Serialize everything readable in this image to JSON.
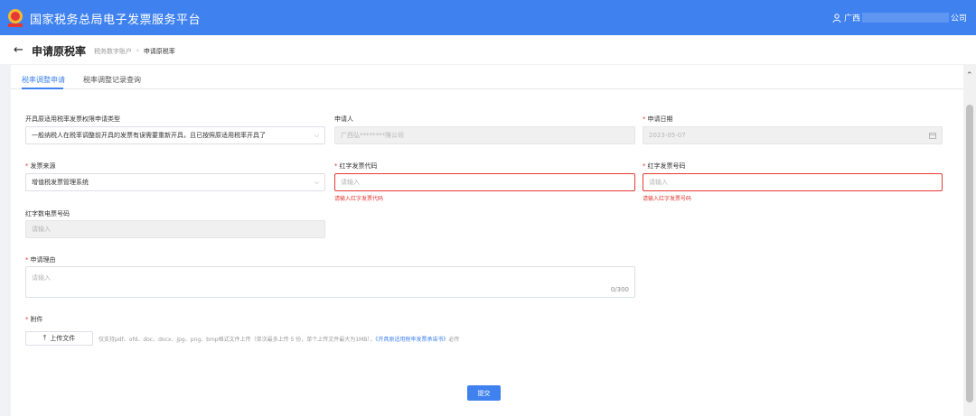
{
  "topbar": {
    "app_title": "国家税务总局电子发票服务平台",
    "user_prefix": "广西",
    "user_suffix": "公司"
  },
  "header": {
    "back_icon": "←",
    "page_title": "申请原税率",
    "breadcrumb": [
      "税务数字账户",
      "申请原税率"
    ]
  },
  "tabs": [
    {
      "label": "税率调整申请",
      "active": true
    },
    {
      "label": "税率调整记录查询",
      "active": false
    }
  ],
  "form": {
    "invoice_type": {
      "label": "开具原适用税率发票权限申请类型",
      "value": "一般纳税人在税率调整前开具的发票有误需要重新开具，且已按照原适用税率开具了"
    },
    "applicant": {
      "label": "申请人",
      "value": "广西弘********限公司"
    },
    "apply_date": {
      "label": "申请日期",
      "value": "2023-05-07"
    },
    "invoice_source": {
      "label": "发票来源",
      "value": "增值税发票管理系统"
    },
    "red_invoice_code": {
      "label": "红字发票代码",
      "placeholder": "请输入",
      "error": "请输入红字发票代码"
    },
    "red_invoice_number": {
      "label": "红字发票号码",
      "placeholder": "请输入",
      "error": "请输入红字发票号码"
    },
    "red_digital_number": {
      "label": "红字数电票号码",
      "placeholder": "请输入"
    },
    "reason": {
      "label": "申请理由",
      "placeholder": "请输入",
      "counter": "0/300"
    },
    "attachment": {
      "label": "附件",
      "upload_label": "上传文件",
      "hint_prefix": "仅支持pdf、ofd、doc、docx、jpg、png、bmp格式文件上传（单次最多上传 5 份，单个上传文件最大为1MB），",
      "hint_link": "《开具原适用税率发票承诺书》",
      "hint_suffix": "必传"
    }
  },
  "submit_label": "提交",
  "colors": {
    "primary": "#3f82ef",
    "error": "#e53935"
  }
}
